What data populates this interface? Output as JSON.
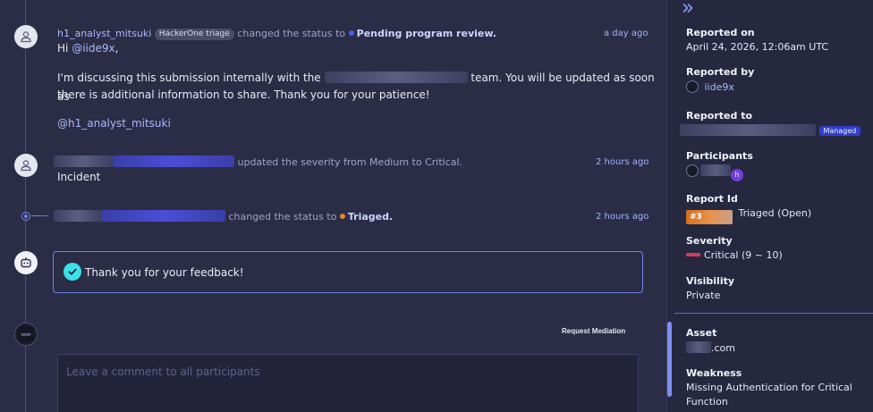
{
  "timeline": {
    "event1": {
      "user": "h1_analyst_mitsuki",
      "badge": "HackerOne triage",
      "action": "changed the status to",
      "status": "Pending program review.",
      "time": "a day ago",
      "greeting_prefix": "Hi",
      "greeting_mention": "@iide9x",
      "greeting_suffix": ",",
      "line2_prefix": "I'm discussing this submission internally with the",
      "line2_suffix": "team. You will be updated as soon as",
      "line3": "there is additional information to share. Thank you for your patience!",
      "signature": "@h1_analyst_mitsuki"
    },
    "event2": {
      "action": "updated the severity from Medium to Critical.",
      "time": "2 hours ago",
      "body": "Incident"
    },
    "event3": {
      "action": "changed the status to",
      "status": "Triaged.",
      "time": "2 hours ago"
    },
    "feedback": {
      "text": "Thank you for your feedback!"
    },
    "composer": {
      "mediation_label": "Request Mediation",
      "placeholder": "Leave a comment to all participants"
    }
  },
  "sidebar": {
    "collapse_icon": "double-chevron-right-icon",
    "reported_on_label": "Reported on",
    "reported_on_value": "April 24, 2026, 12:06am UTC",
    "reported_by_label": "Reported by",
    "reported_by_value": "iide9x",
    "reported_to_label": "Reported to",
    "managed_badge": "Managed",
    "participants_label": "Participants",
    "participant_initial": "h",
    "report_id_label": "Report Id",
    "report_id_value": "#3",
    "report_state": "Triaged (Open)",
    "severity_label": "Severity",
    "severity_value": "Critical (9 ~ 10)",
    "visibility_label": "Visibility",
    "visibility_value": "Private",
    "asset_label": "Asset",
    "asset_value": ".com",
    "weakness_label": "Weakness",
    "weakness_line1": "Missing Authentication for Critical",
    "weakness_line2": "Function"
  },
  "colors": {
    "accent": "#6f83e8",
    "triaged_dot": "#e8842c",
    "pending_dot": "#4a5cf0",
    "severity": "#d33a5a",
    "check": "#3ee0e6"
  }
}
